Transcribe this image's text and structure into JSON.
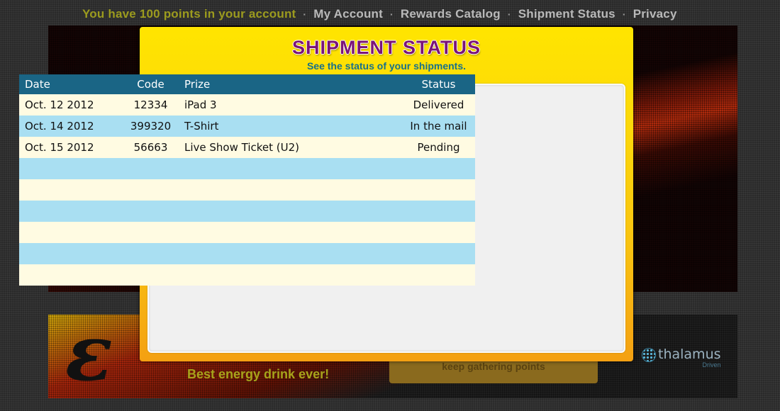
{
  "topnav": {
    "points_text": "You have 100 points in your account",
    "separator": "·",
    "links": [
      "My Account",
      "Rewards Catalog",
      "Shipment Status",
      "Privacy"
    ]
  },
  "banner": {
    "tagline": "Best energy drink ever!",
    "button_text": "keep gathering points",
    "sponsor_brand": "thalamus",
    "sponsor_sub": "Driven"
  },
  "modal": {
    "title": "SHIPMENT STATUS",
    "subtitle": "See the status of your shipments."
  },
  "table": {
    "headers": {
      "date": "Date",
      "code": "Code",
      "prize": "Prize",
      "status": "Status"
    },
    "rows": [
      {
        "date": "Oct. 12 2012",
        "code": "12334",
        "prize": "iPad 3",
        "status": "Delivered"
      },
      {
        "date": "Oct. 14 2012",
        "code": "399320",
        "prize": "T-Shirt",
        "status": "In the mail"
      },
      {
        "date": "Oct. 15 2012",
        "code": "56663",
        "prize": "Live Show Ticket (U2)",
        "status": "Pending"
      },
      {
        "date": "",
        "code": "",
        "prize": "",
        "status": ""
      },
      {
        "date": "",
        "code": "",
        "prize": "",
        "status": ""
      },
      {
        "date": "",
        "code": "",
        "prize": "",
        "status": ""
      },
      {
        "date": "",
        "code": "",
        "prize": "",
        "status": ""
      },
      {
        "date": "",
        "code": "",
        "prize": "",
        "status": ""
      },
      {
        "date": "",
        "code": "",
        "prize": "",
        "status": ""
      }
    ]
  },
  "colors": {
    "header_bg": "#1a6585",
    "row_light": "#fffbe2",
    "row_blue": "#a9dff2",
    "title": "#7b1478",
    "subtitle": "#16708c",
    "modal_top": "#ffe500",
    "modal_bottom": "#f4a012"
  }
}
